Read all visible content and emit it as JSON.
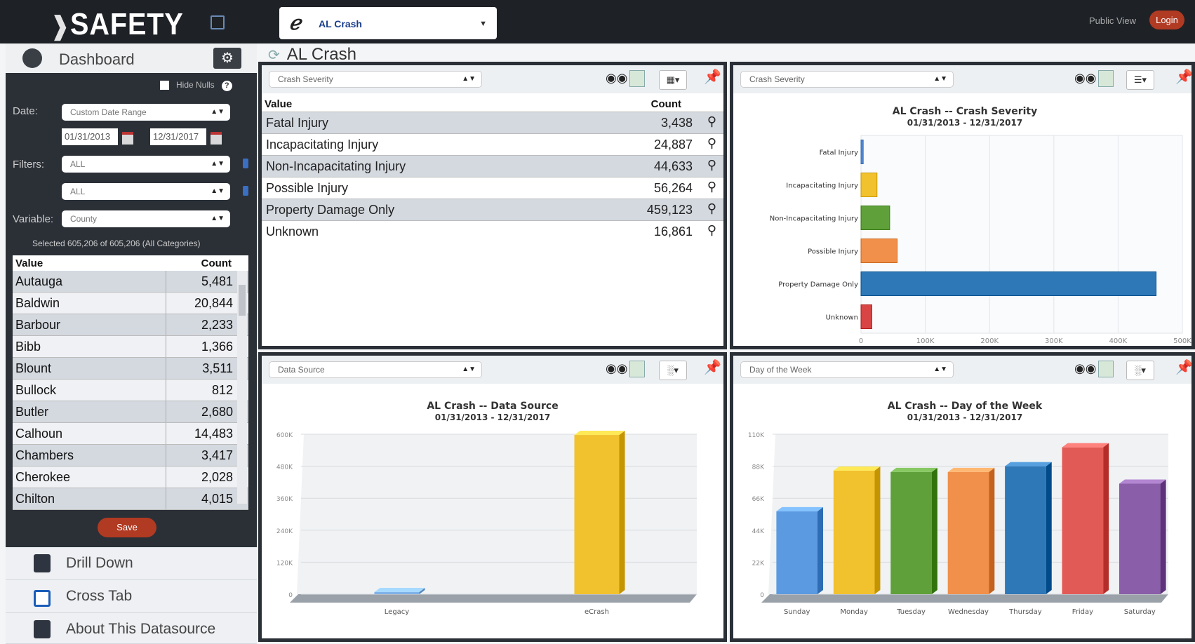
{
  "app": {
    "logo_text": "SAFETY",
    "datasource": "AL Crash",
    "public_view": "Public View",
    "login": "Login"
  },
  "sidebar": {
    "dashboard_label": "Dashboard",
    "hide_nulls": "Hide Nulls",
    "date_label": "Date:",
    "date_range": "Custom Date Range",
    "date_from": "01/31/2013",
    "date_to": "12/31/2017",
    "filters_label": "Filters:",
    "filter1": "ALL",
    "filter2": "ALL",
    "variable_label": "Variable:",
    "variable": "County",
    "selected_text": "Selected 605,206 of 605,206 (All Categories)",
    "table_header": {
      "value": "Value",
      "count": "Count"
    },
    "rows": [
      {
        "value": "Autauga",
        "count": "5,481"
      },
      {
        "value": "Baldwin",
        "count": "20,844"
      },
      {
        "value": "Barbour",
        "count": "2,233"
      },
      {
        "value": "Bibb",
        "count": "1,366"
      },
      {
        "value": "Blount",
        "count": "3,511"
      },
      {
        "value": "Bullock",
        "count": "812"
      },
      {
        "value": "Butler",
        "count": "2,680"
      },
      {
        "value": "Calhoun",
        "count": "14,483"
      },
      {
        "value": "Chambers",
        "count": "3,417"
      },
      {
        "value": "Cherokee",
        "count": "2,028"
      },
      {
        "value": "Chilton",
        "count": "4,015"
      }
    ],
    "save": "Save",
    "links": [
      "Drill Down",
      "Cross Tab",
      "About This Datasource"
    ]
  },
  "breadcrumb": "AL Crash",
  "panel1": {
    "select": "Crash Severity",
    "header": {
      "value": "Value",
      "count": "Count"
    },
    "rows": [
      {
        "value": "Fatal Injury",
        "count": "3,438"
      },
      {
        "value": "Incapacitating Injury",
        "count": "24,887"
      },
      {
        "value": "Non-Incapacitating Injury",
        "count": "44,633"
      },
      {
        "value": "Possible Injury",
        "count": "56,264"
      },
      {
        "value": "Property Damage Only",
        "count": "459,123"
      },
      {
        "value": "Unknown",
        "count": "16,861"
      }
    ]
  },
  "panel2": {
    "select": "Crash Severity"
  },
  "panel3": {
    "select": "Data Source"
  },
  "panel4": {
    "select": "Day of the Week"
  },
  "chart_data": [
    {
      "type": "bar",
      "orientation": "horizontal",
      "title": "AL Crash -- Crash Severity",
      "subtitle": "01/31/2013 - 12/31/2017",
      "categories": [
        "Fatal Injury",
        "Incapacitating Injury",
        "Non-Incapacitating Injury",
        "Possible Injury",
        "Property Damage Only",
        "Unknown"
      ],
      "values": [
        3438,
        24887,
        44633,
        56264,
        459123,
        16861
      ],
      "colors": [
        "#5b8fd6",
        "#f2c12e",
        "#5fa03a",
        "#f0904a",
        "#2e78b7",
        "#d94444"
      ],
      "xlim": [
        0,
        500000
      ],
      "tick_labels": [
        "0",
        "100K",
        "200K",
        "300K",
        "400K",
        "500K"
      ]
    },
    {
      "type": "bar",
      "title": "AL Crash -- Data Source",
      "subtitle": "01/31/2013 - 12/31/2017",
      "categories": [
        "Legacy",
        "eCrash"
      ],
      "values": [
        8000,
        597206
      ],
      "colors": [
        "#7fb2e8",
        "#f2c12e"
      ],
      "ylim": [
        0,
        600000
      ],
      "tick_labels": [
        "0",
        "120K",
        "240K",
        "360K",
        "480K",
        "600K"
      ]
    },
    {
      "type": "bar",
      "title": "AL Crash -- Day of the Week",
      "subtitle": "01/31/2013 - 12/31/2017",
      "categories": [
        "Sunday",
        "Monday",
        "Tuesday",
        "Wednesday",
        "Thursday",
        "Friday",
        "Saturday"
      ],
      "values": [
        57000,
        85000,
        84000,
        84000,
        88000,
        101000,
        76000
      ],
      "colors": [
        "#5b9ae0",
        "#f2c12e",
        "#5fa03a",
        "#f0904a",
        "#2e78b7",
        "#e25a55",
        "#8a5ea8"
      ],
      "ylim": [
        0,
        110000
      ],
      "tick_labels": [
        "0",
        "22K",
        "44K",
        "66K",
        "88K",
        "110K"
      ]
    }
  ]
}
